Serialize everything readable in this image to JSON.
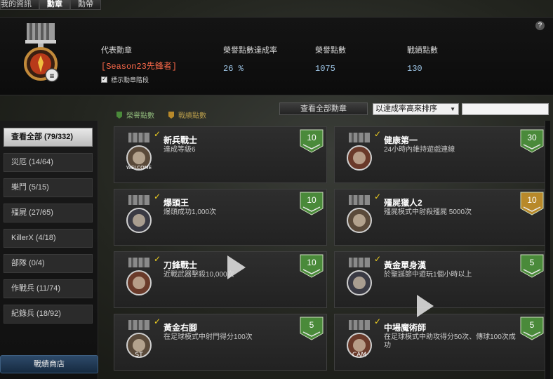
{
  "tabs": [
    {
      "label": "我的資訊"
    },
    {
      "label": "勳章"
    },
    {
      "label": "勳帶"
    }
  ],
  "header": {
    "rep_medal_label": "代表勳章",
    "rep_medal_value": "[Season23先鋒者]",
    "show_level_label": "標示勳章階段",
    "stat1_label": "榮譽點數達成率",
    "stat1_value": "26 %",
    "stat2_label": "榮譽點數",
    "stat2_value": "1075",
    "stat3_label": "戰績點數",
    "stat3_value": "130",
    "help": "?"
  },
  "legend": {
    "honor_label": "榮譽點數",
    "battle_label": "戰績點數",
    "honor_color": "#4a8a3a",
    "battle_color": "#b8892a"
  },
  "controls": {
    "view_all": "查看全部勳章",
    "sort": "以達成率高來排序",
    "search_value": ""
  },
  "sidebar": {
    "categories": [
      {
        "label": "查看全部 (79/332)"
      },
      {
        "label": "災厄 (14/64)"
      },
      {
        "label": "樂鬥 (5/15)"
      },
      {
        "label": "殭屍 (27/65)"
      },
      {
        "label": "KillerX (4/18)"
      },
      {
        "label": "部隊 (0/4)"
      },
      {
        "label": "作戰兵 (11/74)"
      },
      {
        "label": "紀錄兵 (18/92)"
      }
    ],
    "shop": "戰績商店"
  },
  "medals": [
    {
      "name": "新兵戰士",
      "desc": "達成等級6",
      "points": "10",
      "kind": "honor",
      "icon_text": "WELCOME",
      "icon": "welcome-medal-icon"
    },
    {
      "name": "健康第一",
      "desc": "24小時內維持遊戲連線",
      "points": "30",
      "kind": "honor",
      "icon_text": "",
      "icon": "health-medal-icon"
    },
    {
      "name": "爆頭王",
      "desc": "爆頭成功1,000次",
      "points": "10",
      "kind": "honor",
      "icon_text": "",
      "icon": "skull-medal-icon"
    },
    {
      "name": "殭屍獵人2",
      "desc": "殭屍模式中射殺殭屍  5000次",
      "points": "10",
      "kind": "battle",
      "icon_text": "",
      "icon": "zombie-hunter-medal-icon"
    },
    {
      "name": "刀鋒戰士",
      "desc": "近戰武器擊殺10,000次",
      "points": "10",
      "kind": "honor",
      "icon_text": "",
      "icon": "blade-medal-icon"
    },
    {
      "name": "黃金單身漢",
      "desc": "於聖誕節中遊玩1個小時以上",
      "points": "5",
      "kind": "honor",
      "icon_text": "",
      "icon": "golden-single-medal-icon"
    },
    {
      "name": "黃金右腳",
      "desc": "在足球模式中射門得分100次",
      "points": "5",
      "kind": "honor",
      "icon_text": "ST",
      "icon": "golden-foot-medal-icon"
    },
    {
      "name": "中場魔術師",
      "desc": "在足球模式中助攻得分50次、傳球100次成功",
      "points": "5",
      "kind": "honor",
      "icon_text": "CAM",
      "icon": "midfield-medal-icon"
    }
  ]
}
